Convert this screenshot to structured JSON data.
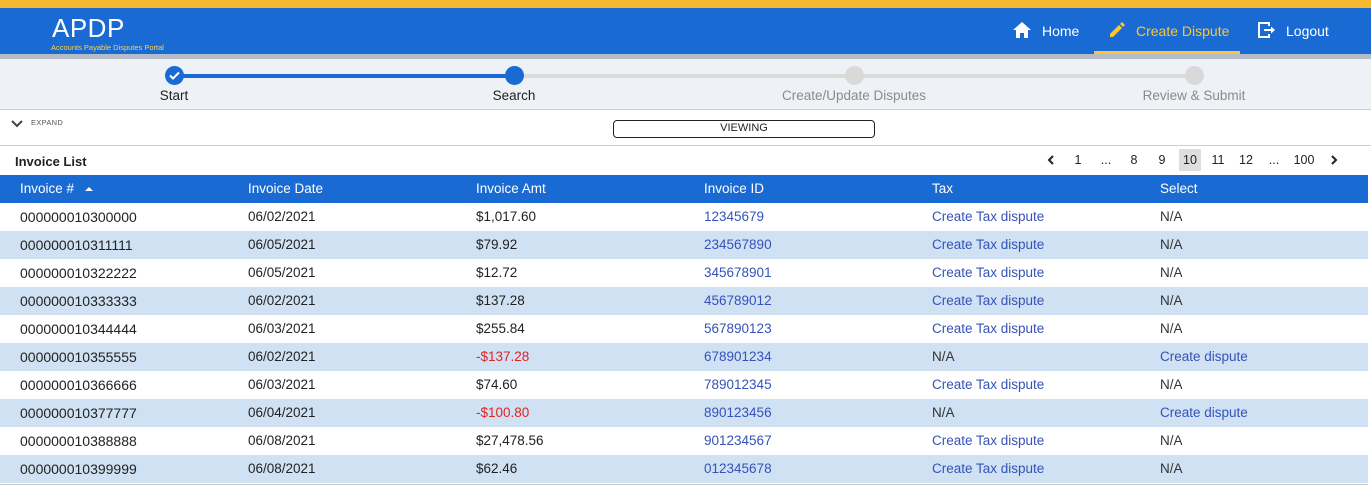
{
  "app": {
    "logo": "APDP",
    "subtitle": "Accounts Payable Disputes Portal"
  },
  "nav": {
    "home": "Home",
    "create_dispute": "Create Dispute",
    "logout": "Logout"
  },
  "stepper": {
    "steps": [
      "Start",
      "Search",
      "Create/Update Disputes",
      "Review & Submit"
    ],
    "completed_steps": 2
  },
  "expand": {
    "label": "EXPAND",
    "viewing_button": "VIEWING"
  },
  "list": {
    "title": "Invoice List"
  },
  "pagination": {
    "prev_icon": "chevron-left-icon",
    "next_icon": "chevron-right-icon",
    "pages": [
      "1",
      "...",
      "8",
      "9",
      "10",
      "11",
      "12",
      "...",
      "100"
    ],
    "current_page": "10"
  },
  "table": {
    "headers": [
      "Invoice #",
      "Invoice Date",
      "Invoice Amt",
      "Invoice ID",
      "Tax",
      "Select"
    ],
    "sort_column": "Invoice #",
    "sort_icon": "sort-ascending-icon",
    "rows": [
      {
        "invoice": "000000010300000",
        "date": "06/02/2021",
        "amount": "$1,017.60",
        "id": "12345679",
        "tax": "Create Tax dispute",
        "select": "N/A"
      },
      {
        "invoice": "000000010311111",
        "date": "06/05/2021",
        "amount": "$79.92",
        "id": "234567890",
        "tax": "Create Tax dispute",
        "select": "N/A"
      },
      {
        "invoice": "000000010322222",
        "date": "06/05/2021",
        "amount": "$12.72",
        "id": "345678901",
        "tax": "Create Tax dispute",
        "select": "N/A"
      },
      {
        "invoice": "000000010333333",
        "date": "06/02/2021",
        "amount": "$137.28",
        "id": "456789012",
        "tax": "Create Tax dispute",
        "select": "N/A"
      },
      {
        "invoice": "000000010344444",
        "date": "06/03/2021",
        "amount": "$255.84",
        "id": "567890123",
        "tax": "Create Tax dispute",
        "select": "N/A"
      },
      {
        "invoice": "000000010355555",
        "date": "06/02/2021",
        "amount": "-$137.28",
        "id": "678901234",
        "tax": "N/A",
        "select": "Create dispute"
      },
      {
        "invoice": "000000010366666",
        "date": "06/03/2021",
        "amount": "$74.60",
        "id": "789012345",
        "tax": "Create Tax dispute",
        "select": "N/A"
      },
      {
        "invoice": "000000010377777",
        "date": "06/04/2021",
        "amount": "-$100.80",
        "id": "890123456",
        "tax": "N/A",
        "select": "Create dispute"
      },
      {
        "invoice": "000000010388888",
        "date": "06/08/2021",
        "amount": "$27,478.56",
        "id": "901234567",
        "tax": "Create Tax dispute",
        "select": "N/A"
      },
      {
        "invoice": "000000010399999",
        "date": "06/08/2021",
        "amount": "$62.46",
        "id": "012345678",
        "tax": "Create Tax dispute",
        "select": "N/A"
      }
    ]
  },
  "colors": {
    "primary": "#1a6ad4",
    "accent": "#f5b82e",
    "row_alt": "#cfe1f3",
    "link": "#3553b8",
    "negative": "#e02424"
  }
}
